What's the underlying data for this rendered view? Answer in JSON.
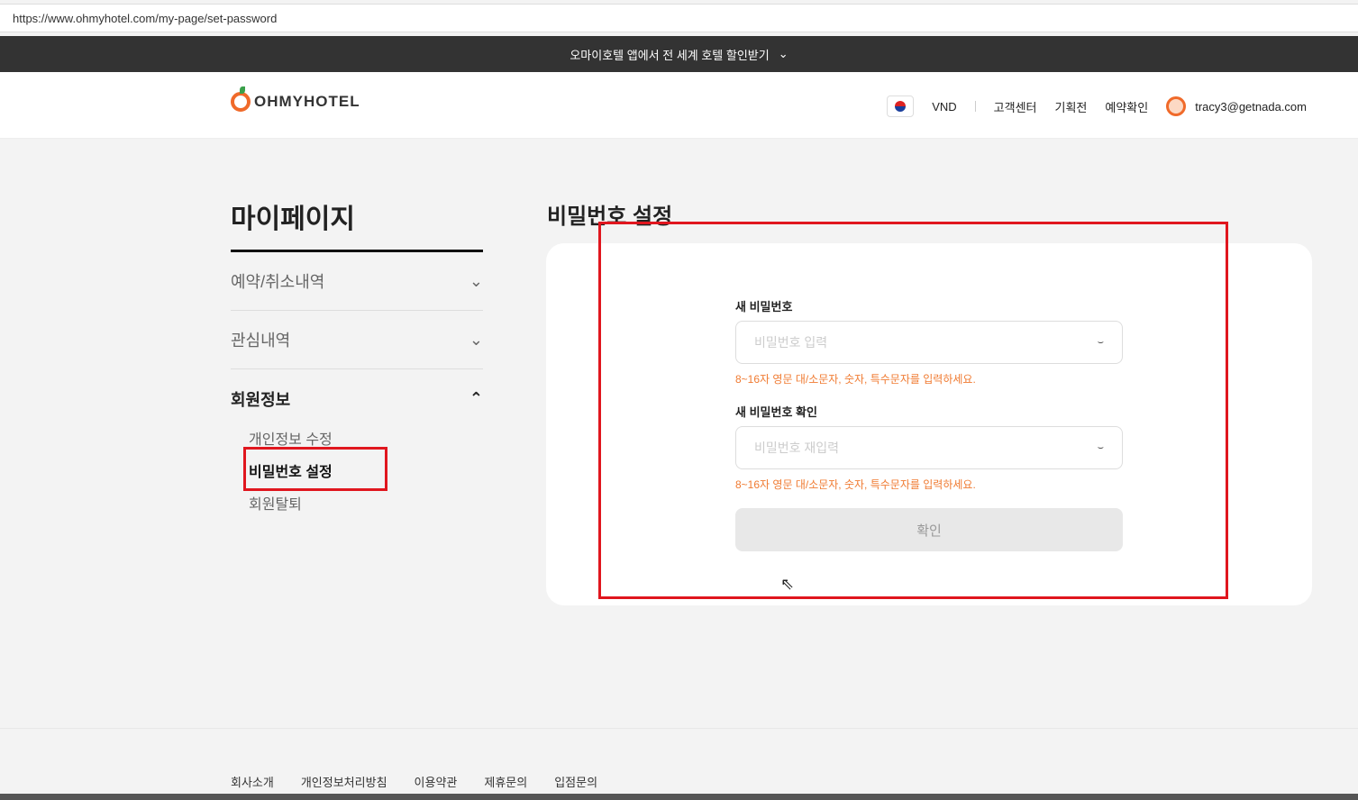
{
  "browser": {
    "url": "https://www.ohmyhotel.com/my-page/set-password"
  },
  "banner": {
    "text": "오마이호텔 앱에서 전 세계 호텔 할인받기"
  },
  "header": {
    "logo": "OHMYHOTEL",
    "currency": "VND",
    "links": [
      "고객센터",
      "기획전",
      "예약확인"
    ],
    "user_email": "tracy3@getnada.com"
  },
  "sidebar": {
    "title": "마이페이지",
    "items": [
      {
        "label": "예약/취소내역"
      },
      {
        "label": "관심내역"
      },
      {
        "label": "회원정보"
      }
    ],
    "sub_items": [
      "개인정보 수정",
      "비밀번호 설정",
      "회원탈퇴"
    ]
  },
  "main": {
    "title": "비밀번호 설정",
    "new_password_label": "새 비밀번호",
    "new_password_placeholder": "비밀번호 입력",
    "confirm_label": "새 비밀번호 확인",
    "confirm_placeholder": "비밀번호 재입력",
    "hint": "8~16자 영문 대/소문자, 숫자, 특수문자를 입력하세요.",
    "submit": "확인"
  },
  "footer": {
    "links": [
      "회사소개",
      "개인정보처리방침",
      "이용약관",
      "제휴문의",
      "입점문의"
    ]
  },
  "colors": {
    "accent": "#f06a2a",
    "highlight": "#e0161e"
  }
}
